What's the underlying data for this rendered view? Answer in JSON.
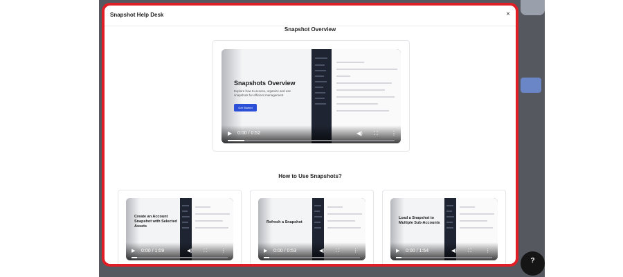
{
  "modal": {
    "title": "Snapshot Help Desk",
    "close_icon": "×"
  },
  "overview": {
    "section_title": "Snapshot Overview",
    "video": {
      "heading": "Snapshots Overview",
      "description": "Explore how to access, organize and use snapshots for efficient management.",
      "cta": "Get Started",
      "time": "0:00 / 0:52",
      "progress": 0.1
    }
  },
  "how_to": {
    "section_title": "How to Use Snapshots?",
    "videos": [
      {
        "heading": "Create an Account Snapshot with Selected Assets",
        "time": "0:00 / 1:09",
        "progress": 0.06
      },
      {
        "heading": "Refresh a Snapshot",
        "time": "0:00 / 0:53",
        "progress": 0.06
      },
      {
        "heading": "Load a Snapshot to Multiple Sub-Accounts",
        "time": "0:00 / 1:54",
        "progress": 0.06
      }
    ]
  },
  "icons": {
    "play": "play-icon",
    "volume": "volume-icon",
    "fullscreen": "fullscreen-icon",
    "more": "more-vertical-icon",
    "close": "close-icon",
    "help": "help-icon"
  },
  "help_button": {
    "label": "?"
  },
  "colors": {
    "highlight_border": "#e01e26",
    "cta": "#2b4fd6",
    "backdrop": "#55585f"
  }
}
